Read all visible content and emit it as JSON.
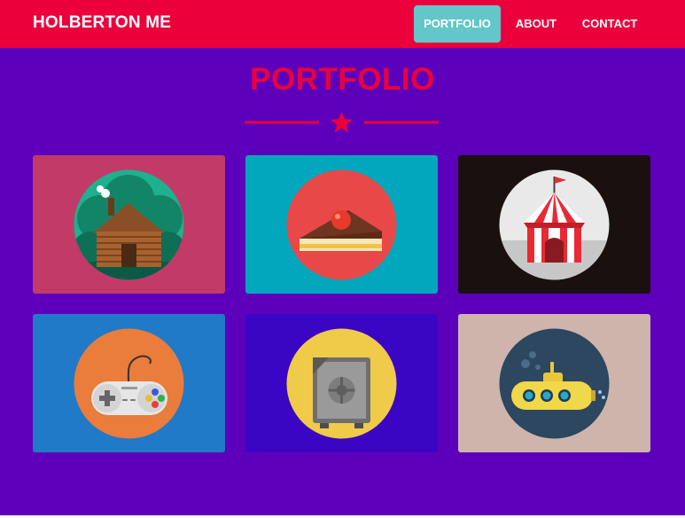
{
  "header": {
    "brand": "HOLBERTON ME",
    "nav": [
      {
        "label": "PORTFOLIO",
        "active": true
      },
      {
        "label": "ABOUT",
        "active": false
      },
      {
        "label": "CONTACT",
        "active": false
      }
    ]
  },
  "section": {
    "title": "PORTFOLIO"
  },
  "colors": {
    "page_bg": "#5d00bb",
    "navbar": "#ec003b",
    "accent": "#ec003b",
    "active_tab": "#63c6c8"
  },
  "portfolio": [
    {
      "icon": "log-cabin-icon",
      "bg": "#c23a67",
      "circle": "#1fb08e"
    },
    {
      "icon": "cake-slice-icon",
      "bg": "#02a7bd",
      "circle": "#e84848"
    },
    {
      "icon": "circus-tent-icon",
      "bg": "#1b1010",
      "circle": "#e9e9e9"
    },
    {
      "icon": "game-controller-icon",
      "bg": "#207ac7",
      "circle": "#ea7c3c"
    },
    {
      "icon": "safe-icon",
      "bg": "#3a06c3",
      "circle": "#f0ca49"
    },
    {
      "icon": "submarine-icon",
      "bg": "#cfb4ab",
      "circle": "#2c475f"
    }
  ]
}
